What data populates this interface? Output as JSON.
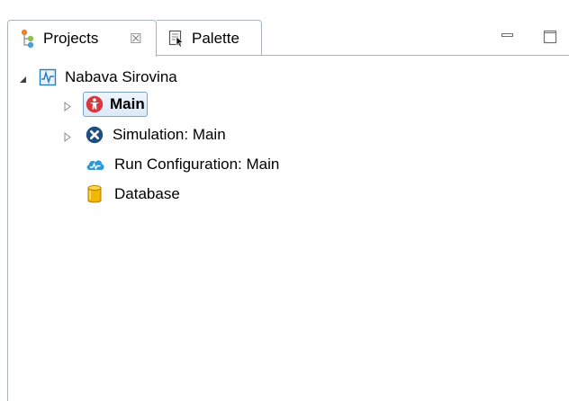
{
  "tabs": [
    {
      "label": "Projects",
      "close": "☒"
    },
    {
      "label": "Palette"
    }
  ],
  "tree": {
    "root": {
      "label": "Nabava Sirovina"
    },
    "children": [
      {
        "label": "Main",
        "selected": true
      },
      {
        "label": "Simulation: Main"
      },
      {
        "label": "Run Configuration: Main"
      },
      {
        "label": "Database"
      }
    ]
  },
  "colors": {
    "accent_red": "#d9363e",
    "accent_navy": "#1f4f7e",
    "accent_cyan": "#2a9bd6",
    "db_yellow": "#f2b700",
    "border": "#a9b4c2",
    "selection_border": "#7da2ce"
  },
  "icons": {
    "projects_tab": "projects-hierarchy-icon",
    "palette_tab": "palette-icon",
    "root": "model-chart-icon",
    "main": "agent-person-icon",
    "simulation": "experiment-x-icon",
    "run_config": "run-configuration-cloud-icon",
    "database": "database-cylinder-icon"
  }
}
